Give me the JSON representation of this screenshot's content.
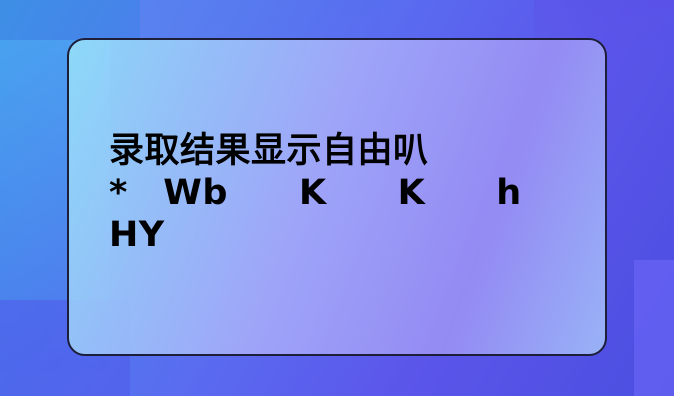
{
  "card": {
    "title": "录取结果显示自由叭　　　　*　Wb　　K　　K　　h　　HY"
  }
}
